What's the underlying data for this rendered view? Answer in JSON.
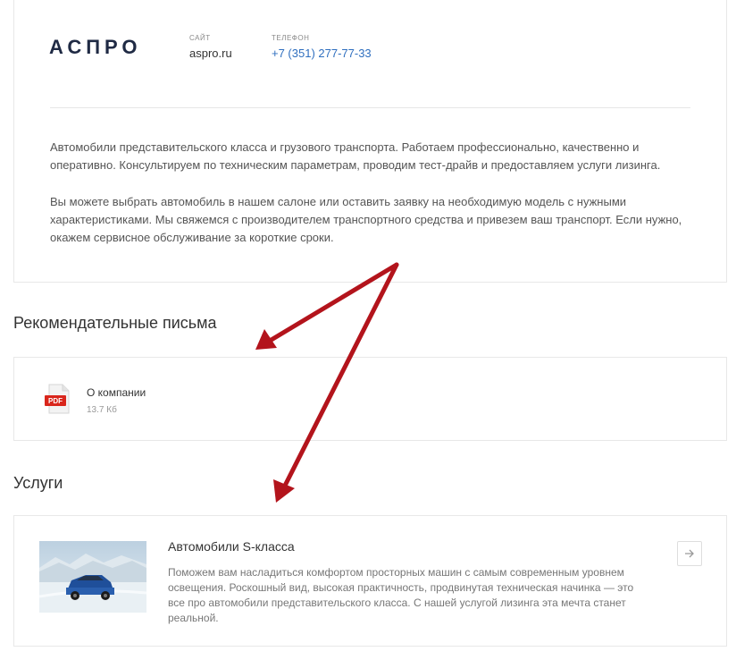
{
  "header": {
    "logo": "АСПРО",
    "site_label": "САЙТ",
    "site_value": "aspro.ru",
    "phone_label": "ТЕЛЕФОН",
    "phone_value": "+7 (351) 277-77-33"
  },
  "about": {
    "paragraph1": "Автомобили представительского класса и грузового транспорта. Работаем профессионально, качественно и оперативно. Консультируем по техническим параметрам, проводим тест-драйв и предоставляем услуги лизинга.",
    "paragraph2": "Вы можете выбрать автомобиль в нашем салоне или оставить заявку на необходимую модель с нужными характеристиками. Мы свяжемся с производителем транспортного средства и привезем ваш транспорт. Если нужно, окажем сервисное обслуживание за короткие сроки."
  },
  "letters": {
    "title": "Рекомендательные письма",
    "items": [
      {
        "icon": "pdf-icon",
        "icon_label": "PDF",
        "name": "О компании",
        "size": "13.7 Кб"
      }
    ]
  },
  "services": {
    "title": "Услуги",
    "items": [
      {
        "title": "Автомобили S-класса",
        "description": "Поможем вам насладиться комфортом просторных машин с самым современным уровнем освещения. Роскошный вид, высокая практичность, продвинутая техническая начинка — это все про автомобили представительского класса. С нашей услугой лизинга эта мечта станет реальной.",
        "arrow_icon": "arrow-right-icon"
      }
    ]
  },
  "colors": {
    "logo": "#1f2a44",
    "link": "#2f6fbf",
    "pdf_red": "#d9261c",
    "annotation_arrow": "#b3141c"
  }
}
